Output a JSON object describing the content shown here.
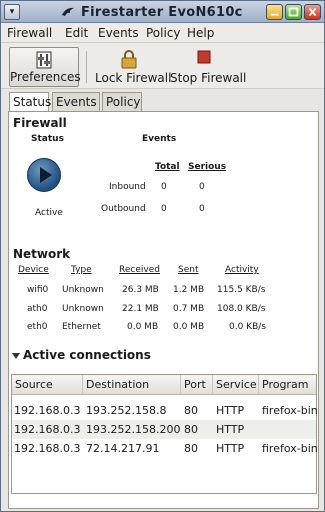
{
  "window": {
    "title": "Firestarter EvoN610c"
  },
  "menu": [
    "Firewall",
    "Edit",
    "Events",
    "Policy",
    "Help"
  ],
  "toolbar": {
    "preferences": "Preferences",
    "lock": "Lock Firewall",
    "stop": "Stop Firewall"
  },
  "tabs": [
    "Status",
    "Events",
    "Policy"
  ],
  "firewall": {
    "title": "Firewall",
    "status_header": "Status",
    "events_header": "Events",
    "total_header": "Total",
    "serious_header": "Serious",
    "state": "Active",
    "rows": [
      {
        "label": "Inbound",
        "total": "0",
        "serious": "0"
      },
      {
        "label": "Outbound",
        "total": "0",
        "serious": "0"
      }
    ]
  },
  "network": {
    "title": "Network",
    "headers": [
      "Device",
      "Type",
      "Received",
      "Sent",
      "Activity"
    ],
    "rows": [
      [
        "wifi0",
        "Unknown",
        "26.3 MB",
        "1.2 MB",
        "115.5 KB/s"
      ],
      [
        "ath0",
        "Unknown",
        "22.1 MB",
        "0.7 MB",
        "108.0 KB/s"
      ],
      [
        "eth0",
        "Ethernet",
        "0.0 MB",
        "0.0 MB",
        "0.0 KB/s"
      ]
    ]
  },
  "connections": {
    "title": "Active connections",
    "headers": [
      "Source",
      "Destination",
      "Port",
      "Service",
      "Program"
    ],
    "rows": [
      [
        "192.168.0.3",
        "193.252.158.8",
        "80",
        "HTTP",
        "firefox-bin"
      ],
      [
        "192.168.0.3",
        "193.252.158.200",
        "80",
        "HTTP",
        ""
      ],
      [
        "192.168.0.3",
        "72.14.217.91",
        "80",
        "HTTP",
        "firefox-bin"
      ]
    ]
  },
  "colors": {
    "titlebar": "#a9b8cc",
    "accent_play": "#2b5c8f"
  },
  "icons": [
    "menu-icon",
    "firestarter-logo-icon",
    "minimize-icon",
    "maximize-icon",
    "close-icon",
    "preferences-icon",
    "lock-icon",
    "stop-icon",
    "play-icon",
    "collapse-arrow-icon"
  ]
}
